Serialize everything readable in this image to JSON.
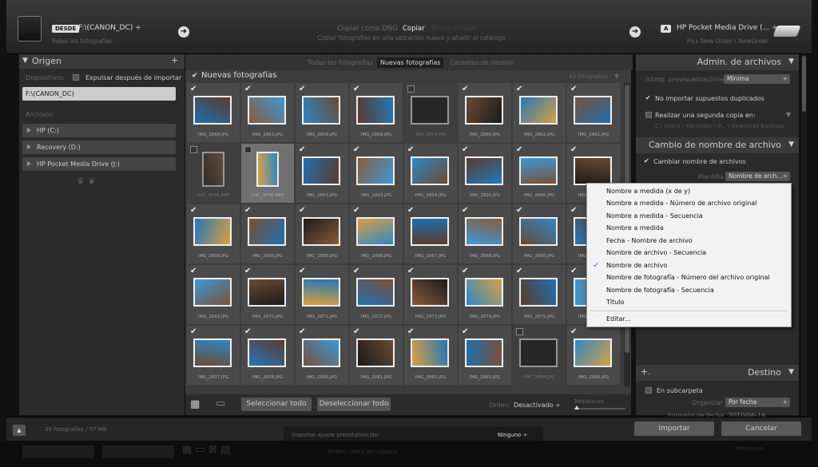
{
  "topbar": {
    "source_badge": "DESDE",
    "source_path": "F:\\(CANON_DC) ÷",
    "source_sub": "Todas las fotografías",
    "modes": [
      "Copiar como DNG",
      "Copiar",
      "Mover",
      "Añadir"
    ],
    "mode_desc": "Copiar fotografías en una ubicación nueva y añadir al catálogo",
    "dest_badge": "A",
    "dest_name": "HP Pocket Media Drive (... ÷",
    "dest_path": "Pics New Order \\ NewOrder"
  },
  "left": {
    "header": "Origen",
    "devices_label": "Dispositivos",
    "eject_label": "Expulsar después de importar",
    "device_item": "F:\\(CANON_DC)",
    "files_label": "Archivos",
    "drives": [
      "HP (C:)",
      "Recovery (D:)",
      "HP Pocket Media Drive (J:)"
    ]
  },
  "center": {
    "view_tabs": [
      "Todas las fotografías",
      "Nuevas fotografías",
      "Carpetas de destino"
    ],
    "section_title": "Nuevas fotografías",
    "count": "43 fotografías",
    "rows": [
      [
        {
          "n": "IMG_2858.JPG",
          "c": true
        },
        {
          "n": "IMG_2863.JPG",
          "c": true
        },
        {
          "n": "IMG_2859.JPG",
          "c": true
        },
        {
          "n": "IMG_2864.JPG",
          "c": true
        },
        {
          "n": "MVI_2879.AVI",
          "c": false,
          "d": true
        },
        {
          "n": "IMG_2860.JPG",
          "c": true
        },
        {
          "n": "IMG_2862.JPG",
          "c": true
        },
        {
          "n": "IMG_2861.JPG",
          "c": true
        }
      ],
      [
        {
          "n": "DSC_4795.NEF",
          "c": false,
          "d": true,
          "p": true
        },
        {
          "n": "DSC_4796.NEF",
          "c": false,
          "p": true,
          "sel": true
        },
        {
          "n": "IMG_2863.JPG",
          "c": true
        },
        {
          "n": "IMG_2893.JPG",
          "c": true
        },
        {
          "n": "IMG_2894.JPG",
          "c": true
        },
        {
          "n": "IMG_2895.JPG",
          "c": true
        },
        {
          "n": "IMG_2896.JPG",
          "c": true
        },
        {
          "n": "IMG_2897.JPG",
          "c": true
        }
      ],
      [
        {
          "n": "IMG_2898.JPG",
          "c": true
        },
        {
          "n": "IMG_2900.JPG",
          "c": true
        },
        {
          "n": "IMG_2885.JPG",
          "c": true
        },
        {
          "n": "IMG_2886.JPG",
          "c": true
        },
        {
          "n": "IMG_2887.JPG",
          "c": true
        },
        {
          "n": "IMG_2888.JPG",
          "c": true
        },
        {
          "n": "IMG_2890.JPG",
          "c": true
        },
        {
          "n": "IMG_2891.JPG",
          "c": true
        }
      ],
      [
        {
          "n": "IMG_2892.JPG",
          "c": true
        },
        {
          "n": "IMG_2870.JPG",
          "c": true
        },
        {
          "n": "IMG_2871.JPG",
          "c": true
        },
        {
          "n": "IMG_2872.JPG",
          "c": true
        },
        {
          "n": "IMG_2873.JPG",
          "c": true
        },
        {
          "n": "IMG_2874.JPG",
          "c": true
        },
        {
          "n": "IMG_2875.JPG",
          "c": true
        },
        {
          "n": "IMG_2876.JPG",
          "c": true
        }
      ],
      [
        {
          "n": "IMG_2877.JPG",
          "c": true
        },
        {
          "n": "IMG_2878.JPG",
          "c": true
        },
        {
          "n": "IMG_2880.JPG",
          "c": true
        },
        {
          "n": "IMG_2881.JPG",
          "c": true
        },
        {
          "n": "IMG_2882.JPG",
          "c": true
        },
        {
          "n": "IMG_2883.JPG",
          "c": true
        },
        {
          "n": "IMG_2884.JPG",
          "c": false,
          "d": true
        },
        {
          "n": "IMG_2866.JPG",
          "c": true
        }
      ]
    ],
    "select_all": "Seleccionar todo",
    "deselect_all": "Deseleccionar todo",
    "order_label": "Orden:",
    "order_value": "Desactivado ÷",
    "thumbs_label": "Miniaturas"
  },
  "right": {
    "file_mgmt_header": "Admin. de archivos",
    "preview_label": "Interp. previsualizaciones:",
    "preview_value": "Mínima",
    "no_dupes_label": "No importar supuestos duplicados",
    "second_copy_label": "Realizar una segunda copia en:",
    "second_copy_path": "C:\\ Users \\ Mercedes \\ P... \\ Download Backups",
    "rename_header": "Cambio de nombre de archivo",
    "rename_label": "Cambiar nombre de archivos",
    "template_label": "Plantilla",
    "template_value": "Nombre de arch...",
    "dest_header": "Destino",
    "subfolder_label": "En subcarpeta",
    "organize_label": "Organizar",
    "organize_value": "Por fecha",
    "date_format_label": "Formato de fecha",
    "date_format_value": "2010/06-16"
  },
  "menu": {
    "items": [
      "Nombre a medida (x de y)",
      "Nombre a medida - Número de archivo original",
      "Nombre a medida - Secuencia",
      "Nombre a medida",
      "Fecha - Nombre de archivo",
      "Nombre de archivo - Secuencia",
      "Nombre de archivo",
      "Nombre de fotografía - Número del archivo original",
      "Nombre de fotografía - Secuencia",
      "Título",
      "Editar..."
    ],
    "checked_index": 6
  },
  "bottom": {
    "summary": "39 fotografías / 57 MB",
    "preset_label": "Importar ajuste preestablecido:",
    "preset_value": "Ninguno ÷",
    "import_btn": "Importar",
    "cancel_btn": "Cancelar",
    "behind_sort_label": "Orden:",
    "behind_sort_value": "Hora de captura",
    "behind_thumbs": "Miniaturas"
  },
  "thumb_colors": [
    "#1f6fb0",
    "#8a5a3a",
    "#2d88c8",
    "#5b3b2b",
    "#3a9ad8",
    "#6a4a32",
    "#2576b8",
    "#7a5038",
    "#1b1b1b",
    "#d8a040"
  ]
}
